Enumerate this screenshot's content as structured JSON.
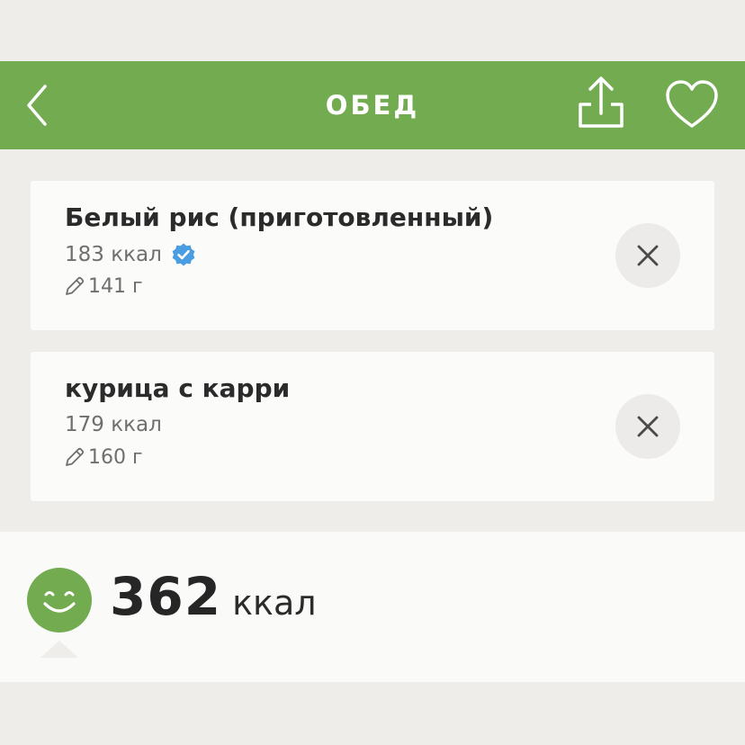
{
  "header": {
    "title": "ОБЕД",
    "back_icon": "chevron-left-icon",
    "share_icon": "share-icon",
    "favorite_icon": "heart-icon",
    "color": "#72ab50"
  },
  "items": [
    {
      "name": "Белый рис (приготовленный)",
      "kcal": "183 ккал",
      "verified": true,
      "portion": "141 г"
    },
    {
      "name": "курица с карри",
      "kcal": "179 ккал",
      "verified": false,
      "portion": "160 г"
    }
  ],
  "summary": {
    "total_value": "362",
    "total_unit": "ккал",
    "mood_icon": "smiley-icon",
    "mood_color": "#72ab50"
  },
  "colors": {
    "background": "#efede9",
    "card": "#fbfbfa",
    "verified_badge": "#4a9de0"
  }
}
